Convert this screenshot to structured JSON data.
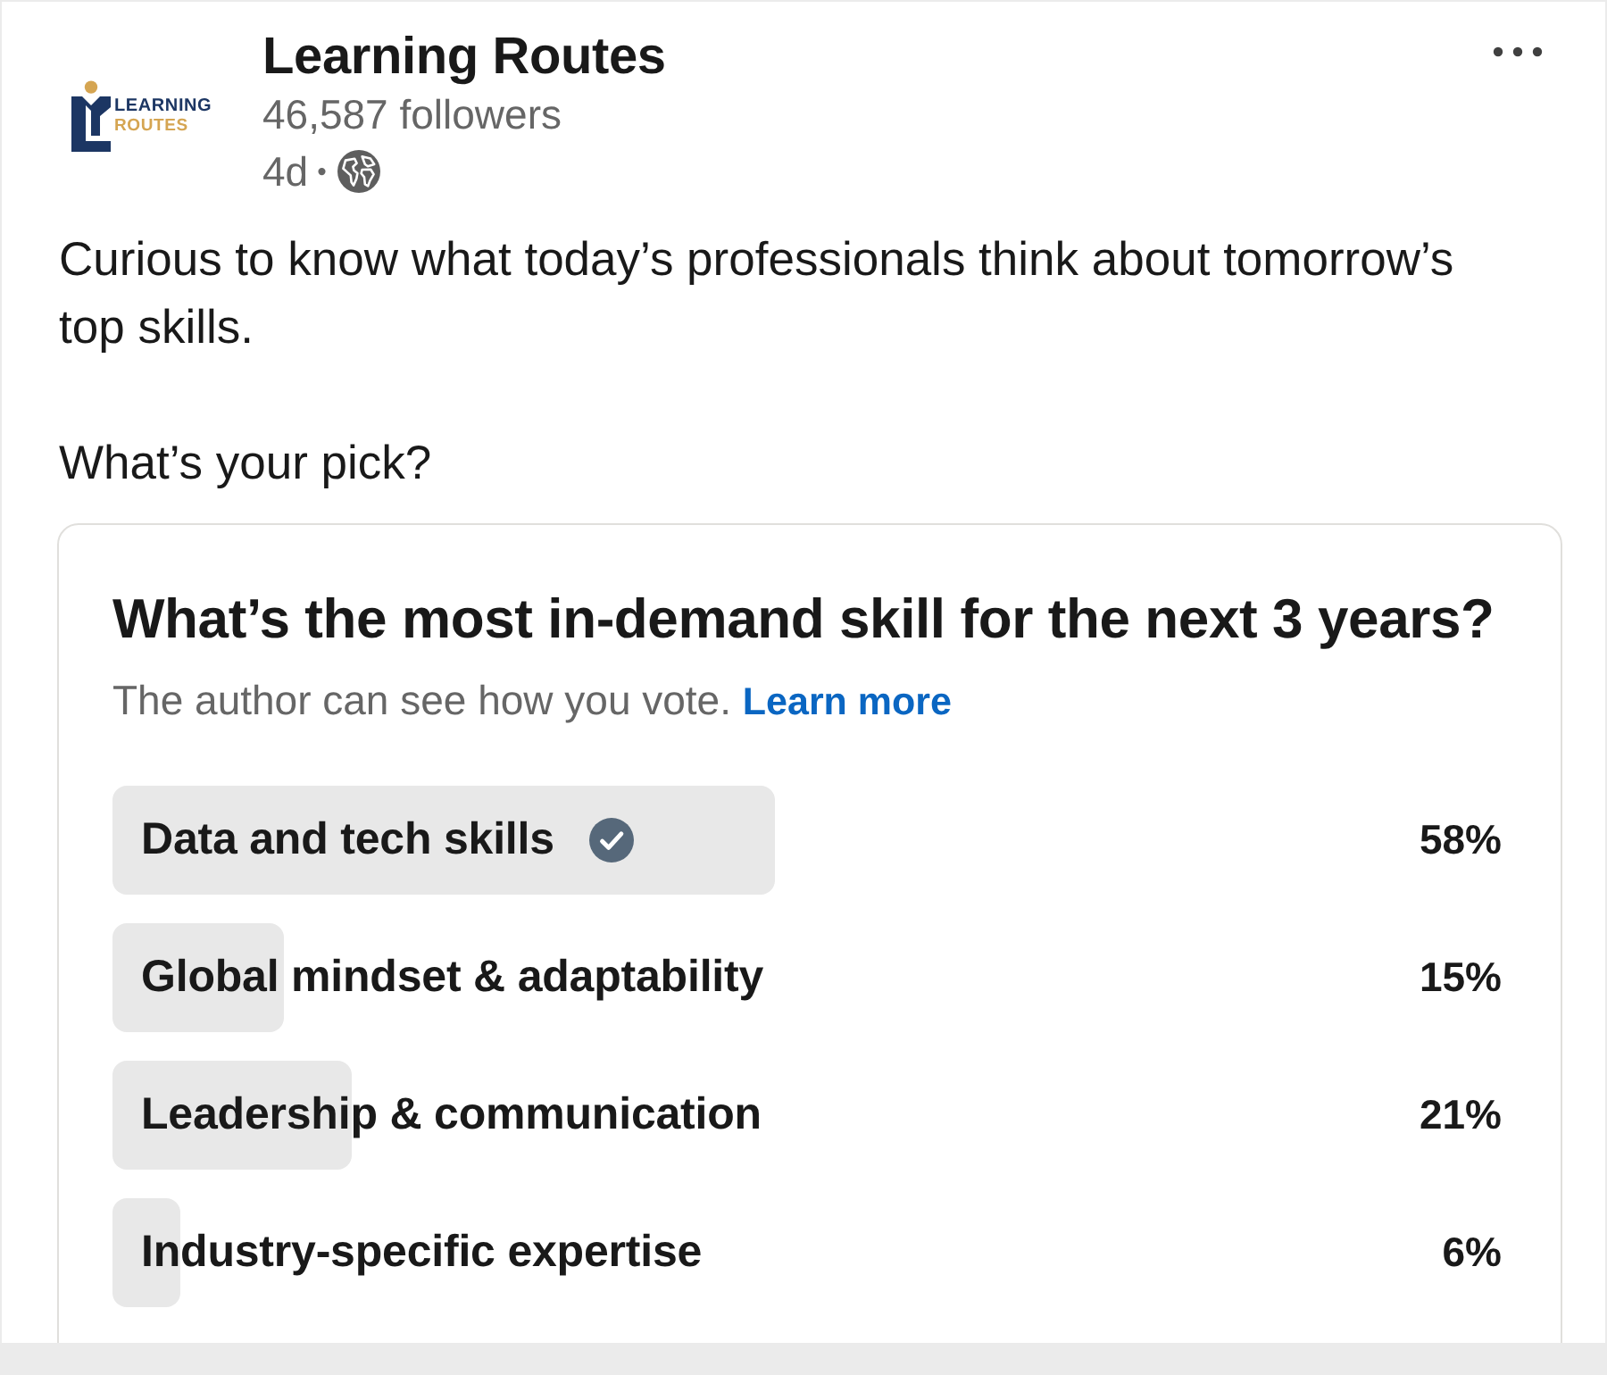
{
  "author": {
    "logo": {
      "lines": [
        "LEARNING",
        "ROUTES"
      ]
    },
    "name": "Learning Routes",
    "followers": "46,587 followers",
    "time": "4d",
    "separator": "•"
  },
  "post_text": [
    "Curious to know what today’s professionals think about tomorrow’s top skills.",
    "What’s your pick?"
  ],
  "poll": {
    "question": "What’s the most in-demand skill for the next 3 years?",
    "notice": "The author can see how you vote.",
    "link": "Learn more",
    "options": [
      {
        "label": "Data and tech skills",
        "selected": true,
        "level": 0.58,
        "percent": "58%"
      },
      {
        "label": "Global mindset & adaptability",
        "selected": false,
        "level": 0.15,
        "percent": "15%"
      },
      {
        "label": "Leadership & communication",
        "selected": false,
        "level": 0.21,
        "percent": "21%"
      },
      {
        "label": "Industry-specific expertise",
        "selected": false,
        "level": 0.06,
        "percent": "6%"
      }
    ]
  }
}
